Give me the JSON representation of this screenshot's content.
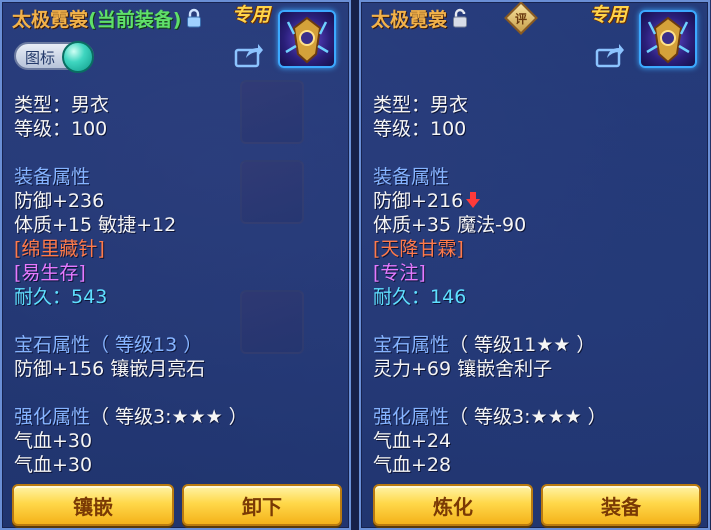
{
  "left": {
    "title_name": "太极霓裳",
    "title_status": "(当前装备)",
    "exclusive": "专用",
    "toggle_label": "图标",
    "type_line": "类型：男衣",
    "level_line": "等级：100",
    "equip_attr_header": "装备属性",
    "attrs": [
      "防御+236",
      "体质+15 敏捷+12"
    ],
    "special_skill": "[绵里藏针]",
    "special_effect": "[易生存]",
    "durability_label": "耐久：",
    "durability_value": "543",
    "gem_header": "宝石属性",
    "gem_level": "（ 等级13 ）",
    "gem_line": "防御+156 镶嵌月亮石",
    "forge_header": "强化属性",
    "forge_level": "（ 等级3:★★★ ）",
    "forge_lines": [
      "气血+30",
      "气血+30"
    ],
    "buttons": [
      "镶嵌",
      "卸下"
    ]
  },
  "right": {
    "title_name": "太极霓裳",
    "rate_badge": "评",
    "exclusive": "专用",
    "type_line": "类型：男衣",
    "level_line": "等级：100",
    "equip_attr_header": "装备属性",
    "attrs": [
      "防御+216",
      "体质+35 魔法-90"
    ],
    "special_skill": "[天降甘霖]",
    "special_effect": "[专注]",
    "durability_label": "耐久：",
    "durability_value": "146",
    "gem_header": "宝石属性",
    "gem_level": "（ 等级11★★ ）",
    "gem_line": "灵力+69 镶嵌舍利子",
    "forge_header": "强化属性",
    "forge_level": "（ 等级3:★★★ ）",
    "forge_lines": [
      "气血+24",
      "气血+28"
    ],
    "buttons": [
      "炼化",
      "装备"
    ]
  },
  "colors": {
    "title_orange": "#f2b24a",
    "current_green": "#5fe06a",
    "section_blue": "#86b4ff",
    "skill_red": "#ff7a4a",
    "effect_purple": "#e57aff",
    "durability_cyan": "#5fe0ff",
    "button_gold": "#ffd84a"
  }
}
